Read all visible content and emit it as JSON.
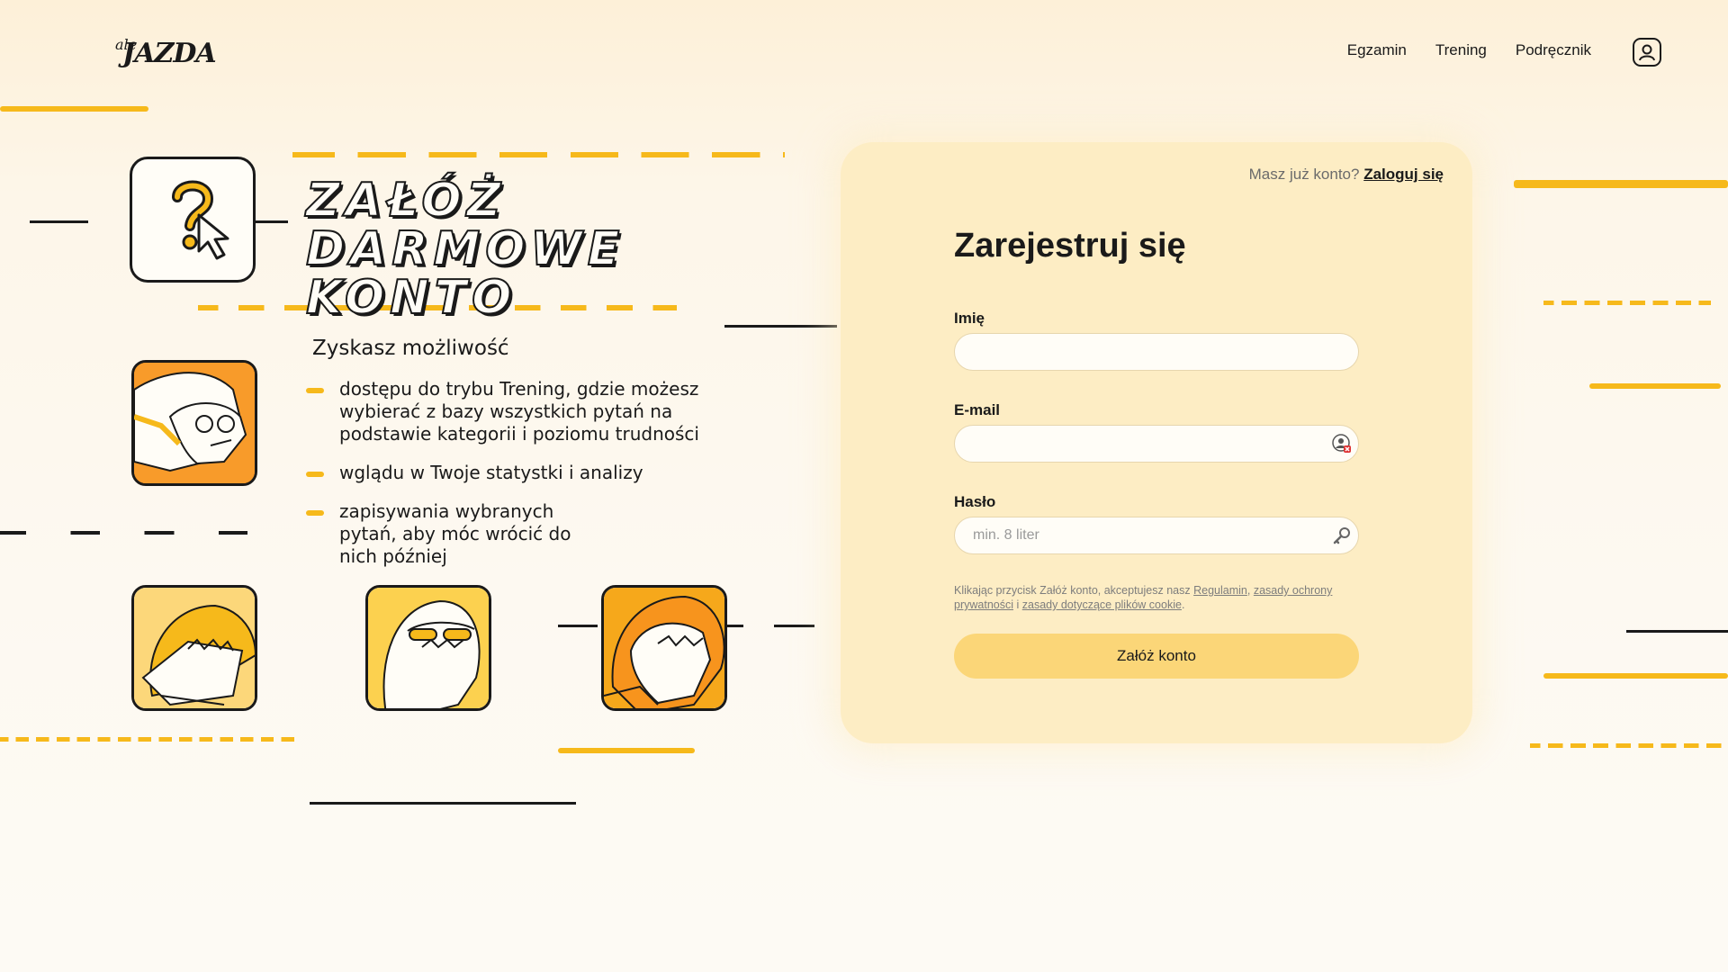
{
  "header": {
    "logo_small": "ale",
    "logo_big": "JAZDA",
    "nav": [
      "Egzamin",
      "Trening",
      "Podręcznik"
    ]
  },
  "hero": {
    "title": "Załóż darmowe konto",
    "benefits_title": "Zyskasz możliwość",
    "benefits": [
      "dostępu do trybu Trening, gdzie możesz wybierać z bazy wszystkich pytań na podstawie kategorii i poziomu trudności",
      "wglądu w Twoje statystki i analizy",
      "zapisywania wybranych pytań, aby móc wrócić do nich później"
    ]
  },
  "form": {
    "have_account_text": "Masz już konto?",
    "login_link": "Zaloguj się",
    "title": "Zarejestruj się",
    "name_label": "Imię",
    "name_value": "",
    "email_label": "E-mail",
    "email_value": "",
    "password_label": "Hasło",
    "password_placeholder": "min. 8 liter",
    "terms_prefix": "Klikając przycisk Załóż konto, akceptujesz nasz",
    "terms_link": "Regulamin",
    "privacy_link": "zasady ochrony prywatności",
    "terms_and": "i",
    "cookies_link": "zasady dotyczące plików cookie",
    "submit_label": "Załóż konto"
  },
  "colors": {
    "accent": "#f6b91b",
    "card": "#fdedc4",
    "button": "#fbd678",
    "orange": "#f7941d"
  },
  "icons": {
    "user": "user-icon",
    "question": "question-cursor-icon",
    "password": "key-icon",
    "email": "autofill-icon"
  }
}
